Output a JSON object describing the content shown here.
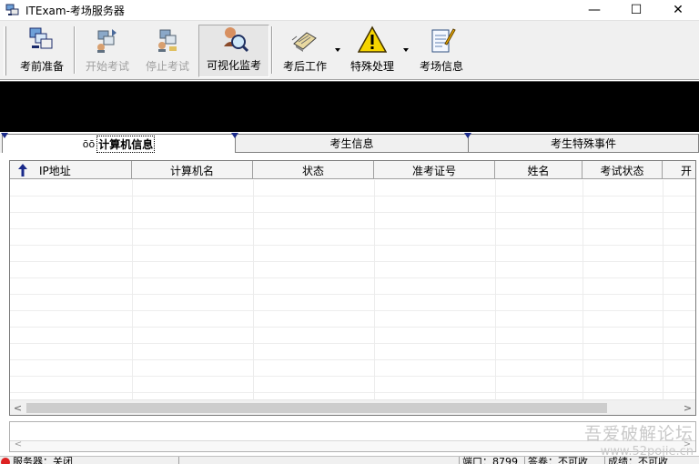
{
  "window": {
    "title": "ITExam-考场服务器",
    "minimize_glyph": "—",
    "maximize_glyph": "☐",
    "close_glyph": "✕"
  },
  "toolbar": {
    "items": [
      {
        "label": "考前准备",
        "icon": "prep-icon",
        "enabled": true
      },
      {
        "label": "开始考试",
        "icon": "start-exam-icon",
        "enabled": false
      },
      {
        "label": "停止考试",
        "icon": "stop-exam-icon",
        "enabled": false
      },
      {
        "label": "可视化监考",
        "icon": "monitor-search-icon",
        "enabled": true,
        "pressed": true
      },
      {
        "label": "考后工作",
        "icon": "book-icon",
        "enabled": true,
        "has_dropdown": true
      },
      {
        "label": "特殊处理",
        "icon": "warning-icon",
        "enabled": true,
        "has_dropdown": true
      },
      {
        "label": "考场信息",
        "icon": "notepad-icon",
        "enabled": true
      }
    ]
  },
  "tabs": [
    {
      "label": "计算机信息",
      "active": true,
      "icon": "glasses-icon"
    },
    {
      "label": "考生信息",
      "active": false
    },
    {
      "label": "考生特殊事件",
      "active": false
    }
  ],
  "grid": {
    "columns": [
      "IP地址",
      "计算机名",
      "状态",
      "准考证号",
      "姓名",
      "考试状态",
      "开"
    ],
    "rows": []
  },
  "statusbar": {
    "cells": [
      "服务器：关闭",
      "",
      "端口：8799",
      "答卷：不可收",
      "成绩：不可收"
    ]
  },
  "watermark": {
    "line1": "吾爱破解论坛",
    "line2": "www.52pojie.cn"
  },
  "colors": {
    "panel_black": "#000000",
    "warning_yellow": "#f5d400",
    "sort_arrow_blue": "#1a2a8a"
  }
}
